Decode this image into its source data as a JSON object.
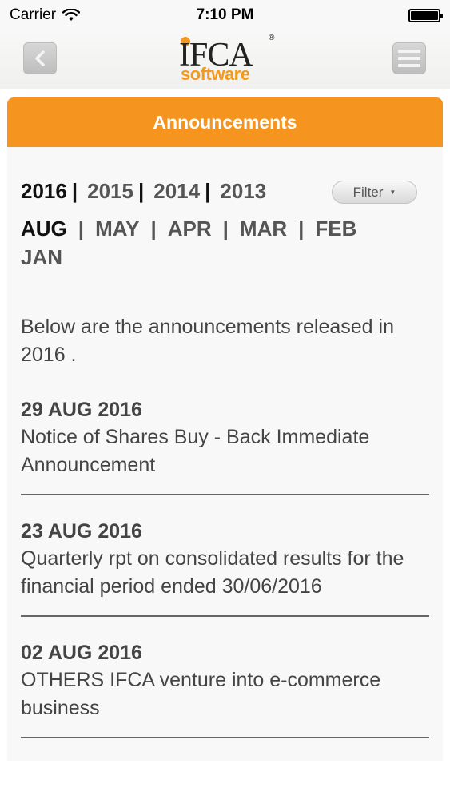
{
  "status_bar": {
    "carrier": "Carrier",
    "time": "7:10 PM",
    "wifi_icon": "wifi-icon",
    "battery_icon": "battery-icon"
  },
  "nav": {
    "back_icon": "chevron-left-icon",
    "menu_icon": "hamburger-menu-icon",
    "logo_top": "IFCA",
    "logo_bottom": "software",
    "logo_mark": "®"
  },
  "page": {
    "title": "Announcements",
    "filter_label": "Filter",
    "years": [
      "2016",
      "2015",
      "2014",
      "2013"
    ],
    "months": [
      "AUG",
      "MAY",
      "APR",
      "MAR",
      "FEB",
      "JAN"
    ],
    "intro": "Below are the announcements released in 2016 ."
  },
  "announcements": [
    {
      "date": "29 AUG 2016",
      "title": "Notice of Shares Buy - Back Immediate Announcement"
    },
    {
      "date": "23 AUG 2016",
      "title": "Quarterly rpt on consolidated results for the financial period ended 30/06/2016"
    },
    {
      "date": "02 AUG 2016",
      "title": "OTHERS IFCA venture into e-commerce business"
    }
  ],
  "colors": {
    "accent": "#f5951f",
    "text": "#444444"
  }
}
